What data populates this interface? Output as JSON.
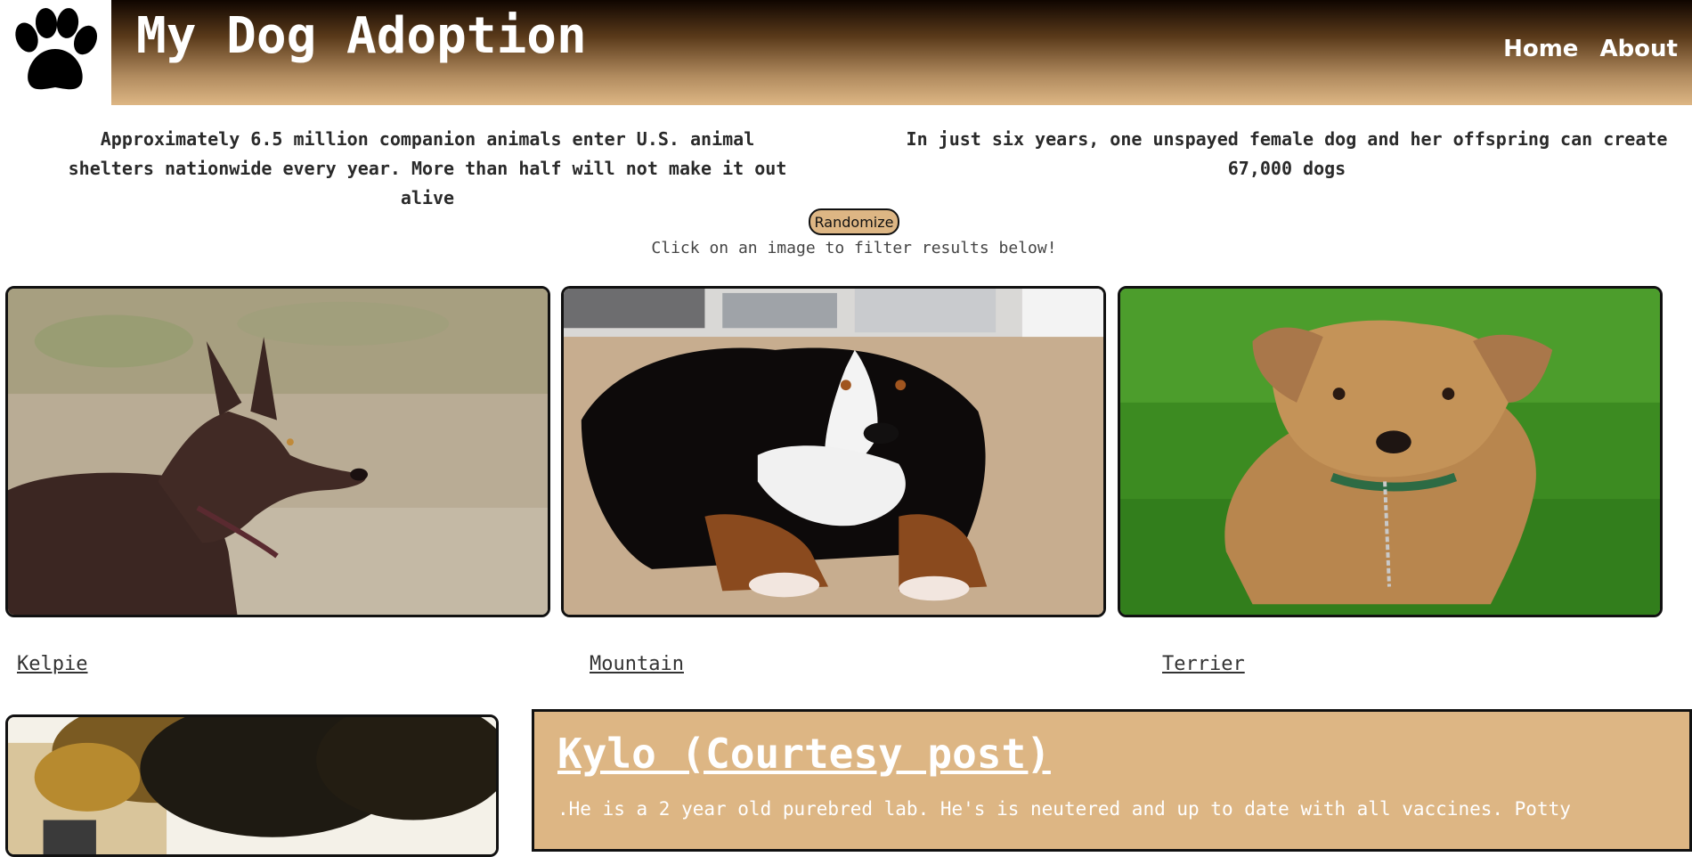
{
  "header": {
    "logo_icon": "paw-print-icon",
    "title": "My Dog Adoption",
    "nav": [
      {
        "label": "Home"
      },
      {
        "label": "About"
      }
    ]
  },
  "facts": [
    "Approximately 6.5 million companion animals enter U.S. animal shelters nationwide every year. More than half will not make it out alive",
    "In just six years, one unspayed female dog and her offspring can create 67,000 dogs"
  ],
  "controls": {
    "randomize_label": "Randomize",
    "hint": "Click on an image to filter results below!"
  },
  "breeds": [
    {
      "label": "Kelpie"
    },
    {
      "label": "Mountain"
    },
    {
      "label": "Terrier"
    }
  ],
  "listing": {
    "title": "Kylo (Courtesy post)",
    "description": ".He is a 2 year old purebred lab. He's is neutered and up to date with all vaccines. Potty"
  },
  "colors": {
    "accent": "#ddb684",
    "header_dark": "#0f0500",
    "border": "#111111"
  }
}
